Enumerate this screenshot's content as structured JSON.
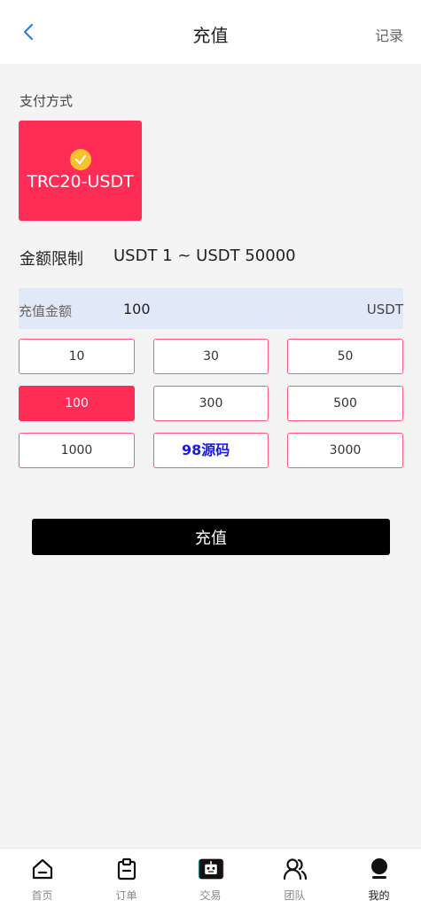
{
  "header": {
    "title": "充值",
    "record_label": "记录"
  },
  "payment": {
    "section_label": "支付方式",
    "method_name": "TRC20-USDT"
  },
  "limit": {
    "label": "金额限制",
    "range": "USDT 1 ~ USDT 50000"
  },
  "amount": {
    "label": "充值金额",
    "value": "100",
    "unit": "USDT"
  },
  "presets": [
    {
      "label": "10"
    },
    {
      "label": "30"
    },
    {
      "label": "50"
    },
    {
      "label": "100"
    },
    {
      "label": "300"
    },
    {
      "label": "500"
    },
    {
      "label": "1000"
    },
    {
      "label": ""
    },
    {
      "label": "3000"
    }
  ],
  "selected_preset": "100",
  "watermark": "98源码",
  "submit_label": "充值",
  "tabbar": {
    "items": [
      {
        "label": "首页",
        "icon": "home-icon"
      },
      {
        "label": "订单",
        "icon": "clipboard-icon"
      },
      {
        "label": "交易",
        "icon": "robot-icon"
      },
      {
        "label": "团队",
        "icon": "team-icon"
      },
      {
        "label": "我的",
        "icon": "user-icon"
      }
    ],
    "active_index": 4
  },
  "colors": {
    "accent": "#ff2d55",
    "check": "#f7c22e",
    "amount_bg": "#e1e8f7",
    "back_arrow": "#2f7ee8"
  }
}
